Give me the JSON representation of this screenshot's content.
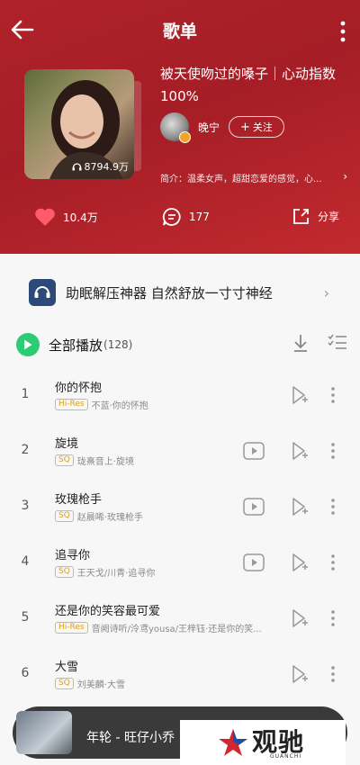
{
  "header": {
    "title": "歌单",
    "playlist_title": "被天使吻过的嗓子｜心动指数100%",
    "play_count": "8794.9万",
    "creator_name": "晚宁",
    "follow_label": "关注",
    "intro": "简介：温柔女声，超甜恋爱的感觉，心...",
    "likes": "10.4万",
    "comments": "177",
    "share_label": "分享"
  },
  "banner": {
    "text": "助眠解压神器 自然舒放一寸寸神经"
  },
  "play_all": {
    "label": "全部播放",
    "count": "(128)"
  },
  "tracks": [
    {
      "index": "1",
      "name": "你的怀抱",
      "badge": "Hi-Res",
      "artist": "不蓝·你的怀抱",
      "has_mv": false
    },
    {
      "index": "2",
      "name": "旋境",
      "badge": "SQ",
      "artist": "珑熹音上·旋境",
      "has_mv": true
    },
    {
      "index": "3",
      "name": "玫瑰枪手",
      "badge": "SQ",
      "artist": "赵晨唏·玫瑰枪手",
      "has_mv": true
    },
    {
      "index": "4",
      "name": "追寻你",
      "badge": "SQ",
      "artist": "王天戈/川青·追寻你",
      "has_mv": true
    },
    {
      "index": "5",
      "name": "还是你的笑容最可爱",
      "badge": "Hi-Res",
      "artist": "音阙诗听/泠鸢yousa/王梓钰·还是你的笑...",
      "has_mv": false
    },
    {
      "index": "6",
      "name": "大雪",
      "badge": "SQ",
      "artist": "刘美麟·大雪",
      "has_mv": false
    }
  ],
  "mini_player": {
    "title": "年轮 - 旺仔小乔"
  },
  "watermark": {
    "text": "观驰",
    "sub": "GUANCHI"
  },
  "colors": {
    "header_red": "#b0222a",
    "play_green": "#2dcb73",
    "badge_gold": "#d9a020"
  }
}
